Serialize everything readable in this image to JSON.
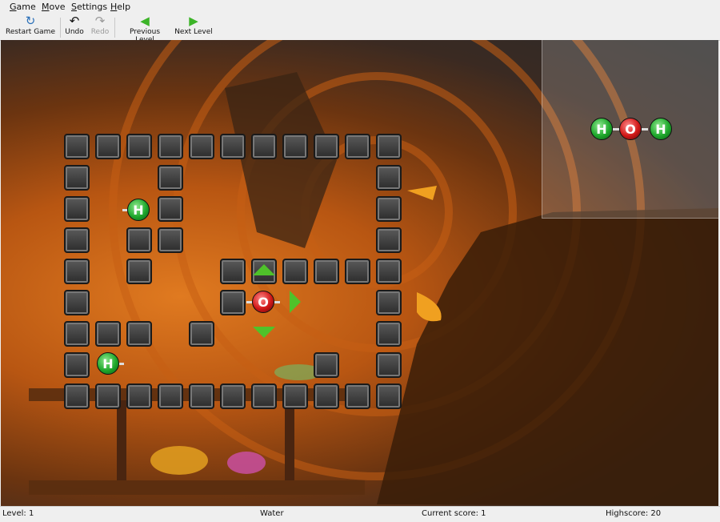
{
  "menu": {
    "items": [
      "Game",
      "Move",
      "Settings",
      "Help"
    ]
  },
  "toolbar": {
    "restart": "Restart Game",
    "undo": "Undo",
    "redo": "Redo",
    "previous_level": "Previous Level",
    "next_level": "Next Level"
  },
  "preview": {
    "atoms": [
      "H",
      "O",
      "H"
    ]
  },
  "board": {
    "atoms": [
      {
        "symbol": "H",
        "kind": "h"
      },
      {
        "symbol": "H",
        "kind": "h"
      },
      {
        "symbol": "O",
        "kind": "o"
      }
    ]
  },
  "status": {
    "level": "Level: 1",
    "molecule": "Water",
    "current_score": "Current score: 1",
    "highscore": "Highscore: 20"
  },
  "colors": {
    "hydrogen": "#1fa82c",
    "oxygen": "#d11818",
    "arrow": "#4fc22a"
  }
}
